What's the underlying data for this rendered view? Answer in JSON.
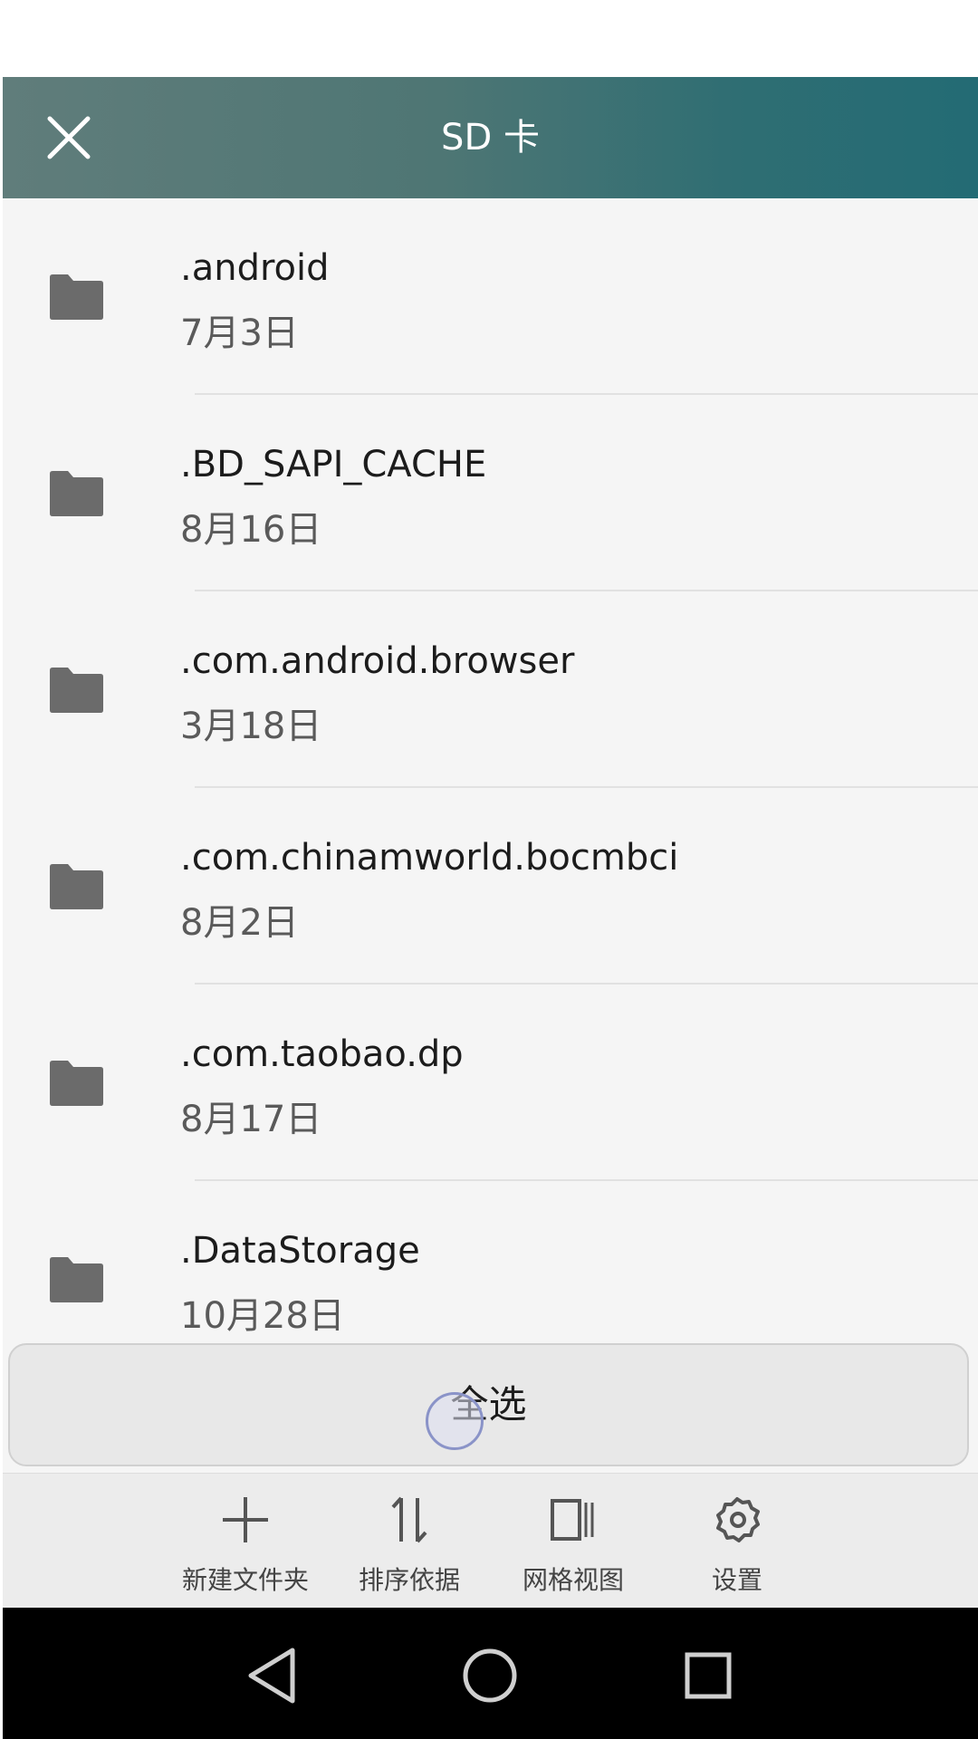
{
  "header": {
    "title": "SD 卡"
  },
  "files": [
    {
      "name": ".android",
      "date": "7月3日"
    },
    {
      "name": ".BD_SAPI_CACHE",
      "date": "8月16日"
    },
    {
      "name": ".com.android.browser",
      "date": "3月18日"
    },
    {
      "name": ".com.chinamworld.bocmbci",
      "date": "8月2日"
    },
    {
      "name": ".com.taobao.dp",
      "date": "8月17日"
    },
    {
      "name": ".DataStorage",
      "date": "10月28日"
    }
  ],
  "select_all": {
    "label": "全选"
  },
  "toolbar": {
    "new_folder": {
      "label": "新建文件夹",
      "icon": "plus-icon"
    },
    "sort": {
      "label": "排序依据",
      "icon": "sort-icon"
    },
    "grid_view": {
      "label": "网格视图",
      "icon": "grid-view-icon"
    },
    "settings": {
      "label": "设置",
      "icon": "gear-icon"
    }
  },
  "navbar": {
    "back_icon": "back-triangle-icon",
    "home_icon": "home-circle-icon",
    "recents_icon": "recents-square-icon"
  },
  "colors": {
    "header_start": "#607d7b",
    "header_end": "#236b74",
    "folder_icon": "#6b6b6b",
    "list_background": "#f5f5f5"
  }
}
